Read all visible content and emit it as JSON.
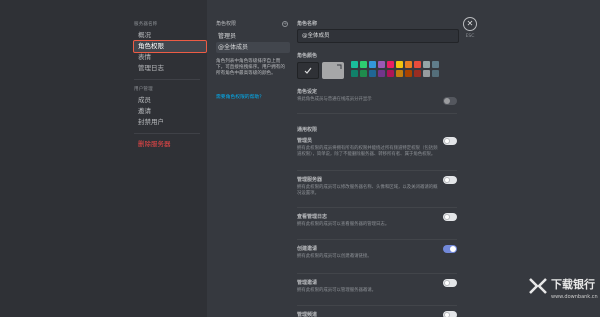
{
  "sidebar": {
    "header1": "服务器名称",
    "items1": [
      "概况",
      "角色权限",
      "表情",
      "管理日志"
    ],
    "header2": "用户管理",
    "items2": [
      "成员",
      "邀请",
      "封禁用户"
    ],
    "danger": "删除服务器",
    "selected": "角色权限"
  },
  "roles": {
    "title": "角色权限",
    "add_icon": "plus-circle-icon",
    "items": [
      "管理员",
      "@全体成员"
    ],
    "selected": "@全体成员",
    "description": "角色列表中角色等级排序自上而下，可直接拖拽排序。用户拥有的所有角色中最高等级的颜色。",
    "help_link": "需要角色权限的帮助？"
  },
  "main": {
    "name_label": "角色名称",
    "name_value": "@全体成员",
    "color_label": "角色颜色",
    "selected_color": "#a6a7a8",
    "swatch_colors": [
      "#1abc9c",
      "#2ecc71",
      "#3498db",
      "#9b59b6",
      "#e91e63",
      "#f1c40f",
      "#e67e22",
      "#e74c3c",
      "#95a5a6",
      "#607d8b",
      "#11806a",
      "#1f8b4c",
      "#206694",
      "#71368a",
      "#ad1457",
      "#c27c0e",
      "#a84300",
      "#992d22",
      "#979c9f",
      "#546e7a"
    ],
    "settings_label": "角色设定",
    "settings_desc": "将此角色成员与普通在线成员分开显示",
    "general_label": "通用权限",
    "permissions": [
      {
        "title": "管理员",
        "desc": "拥有此权限的成员将拥有所有的权限并能绕过所有频道特定权限（包括频道权限），简单说，除了不能删除服务器、转移所有者、属于角色权限。",
        "state": "white"
      },
      {
        "title": "管理服务器",
        "desc": "拥有此权限的成员可以修改服务器名称、头像和区域，以及关闭邀请的概况设置项。",
        "state": "white"
      },
      {
        "title": "查看管理日志",
        "desc": "拥有此权限的成员可以查看服务器的管理日志。",
        "state": "white"
      },
      {
        "title": "创建邀请",
        "desc": "拥有此权限的成员可以创建邀请链接。",
        "state": "blue"
      },
      {
        "title": "管理邀请",
        "desc": "拥有此权限的成员可以管理服务器邀请。",
        "state": "white"
      },
      {
        "title": "管理频道",
        "desc": "",
        "state": "white"
      }
    ]
  },
  "close": {
    "icon": "close-icon",
    "esc_label": "ESC"
  },
  "watermark": {
    "title": "下载银行",
    "url": "www.downbank.cn"
  }
}
